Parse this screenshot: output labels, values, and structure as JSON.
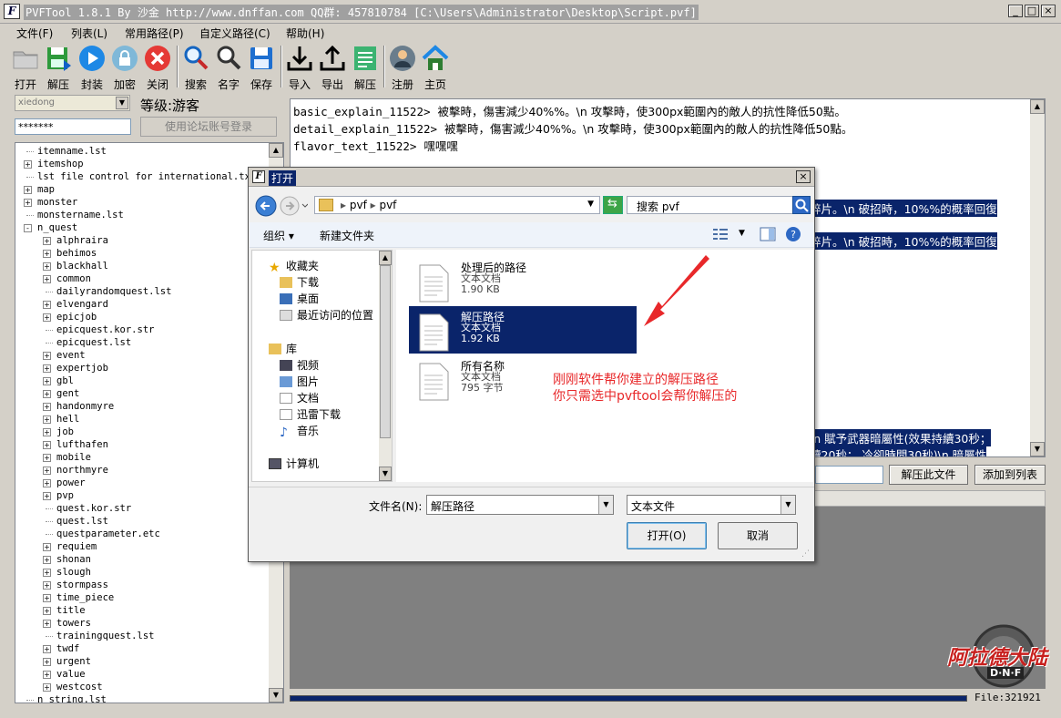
{
  "window": {
    "title": "PVFTool 1.8.1 By 沙金 http://www.dnffan.com QQ群: 457810784 [C:\\Users\\Administrator\\Desktop\\Script.pvf]",
    "app_icon": "F",
    "minimize": "_",
    "maximize": "□",
    "close": "×"
  },
  "menu": [
    "文件(F)",
    "列表(L)",
    "常用路径(P)",
    "自定义路径(C)",
    "帮助(H)"
  ],
  "toolbar": [
    {
      "label": "打开",
      "icon": "folder-icon"
    },
    {
      "label": "解压",
      "icon": "save-green-icon"
    },
    {
      "label": "封装",
      "icon": "play-icon"
    },
    {
      "label": "加密",
      "icon": "lock-icon"
    },
    {
      "label": "关闭",
      "icon": "close-red-icon"
    },
    {
      "label": "搜索",
      "icon": "magnifier-icon"
    },
    {
      "label": "名字",
      "icon": "magnifier-icon"
    },
    {
      "label": "保存",
      "icon": "floppy-icon"
    },
    {
      "label": "导入",
      "icon": "download-icon"
    },
    {
      "label": "导出",
      "icon": "upload-icon"
    },
    {
      "label": "解压",
      "icon": "document-green-icon"
    },
    {
      "label": "注册",
      "icon": "user-icon"
    },
    {
      "label": "主页",
      "icon": "home-icon"
    }
  ],
  "login": {
    "user": "xiedong",
    "level": "等级:游客",
    "password": "*******",
    "forum_login": "使用论坛账号登录"
  },
  "tree": [
    {
      "label": "itemname.lst",
      "indent": 0,
      "expand": ""
    },
    {
      "label": "itemshop",
      "indent": 0,
      "expand": "+"
    },
    {
      "label": "lst file control for international.txt",
      "indent": 0,
      "expand": ""
    },
    {
      "label": "map",
      "indent": 0,
      "expand": "+"
    },
    {
      "label": "monster",
      "indent": 0,
      "expand": "+"
    },
    {
      "label": "monstername.lst",
      "indent": 0,
      "expand": ""
    },
    {
      "label": "n_quest",
      "indent": 0,
      "expand": "-"
    },
    {
      "label": "alphraira",
      "indent": 1,
      "expand": "+"
    },
    {
      "label": "behimos",
      "indent": 1,
      "expand": "+"
    },
    {
      "label": "blackhall",
      "indent": 1,
      "expand": "+"
    },
    {
      "label": "common",
      "indent": 1,
      "expand": "+"
    },
    {
      "label": "dailyrandomquest.lst",
      "indent": 1,
      "expand": ""
    },
    {
      "label": "elvengard",
      "indent": 1,
      "expand": "+"
    },
    {
      "label": "epicjob",
      "indent": 1,
      "expand": "+"
    },
    {
      "label": "epicquest.kor.str",
      "indent": 1,
      "expand": ""
    },
    {
      "label": "epicquest.lst",
      "indent": 1,
      "expand": ""
    },
    {
      "label": "event",
      "indent": 1,
      "expand": "+"
    },
    {
      "label": "expertjob",
      "indent": 1,
      "expand": "+"
    },
    {
      "label": "gbl",
      "indent": 1,
      "expand": "+"
    },
    {
      "label": "gent",
      "indent": 1,
      "expand": "+"
    },
    {
      "label": "handonmyre",
      "indent": 1,
      "expand": "+"
    },
    {
      "label": "hell",
      "indent": 1,
      "expand": "+"
    },
    {
      "label": "job",
      "indent": 1,
      "expand": "+"
    },
    {
      "label": "lufthafen",
      "indent": 1,
      "expand": "+"
    },
    {
      "label": "mobile",
      "indent": 1,
      "expand": "+"
    },
    {
      "label": "northmyre",
      "indent": 1,
      "expand": "+"
    },
    {
      "label": "power",
      "indent": 1,
      "expand": "+"
    },
    {
      "label": "pvp",
      "indent": 1,
      "expand": "+"
    },
    {
      "label": "quest.kor.str",
      "indent": 1,
      "expand": ""
    },
    {
      "label": "quest.lst",
      "indent": 1,
      "expand": ""
    },
    {
      "label": "questparameter.etc",
      "indent": 1,
      "expand": ""
    },
    {
      "label": "requiem",
      "indent": 1,
      "expand": "+"
    },
    {
      "label": "shonan",
      "indent": 1,
      "expand": "+"
    },
    {
      "label": "slough",
      "indent": 1,
      "expand": "+"
    },
    {
      "label": "stormpass",
      "indent": 1,
      "expand": "+"
    },
    {
      "label": "time_piece",
      "indent": 1,
      "expand": "+"
    },
    {
      "label": "title",
      "indent": 1,
      "expand": "+"
    },
    {
      "label": "towers",
      "indent": 1,
      "expand": "+"
    },
    {
      "label": "trainingquest.lst",
      "indent": 1,
      "expand": ""
    },
    {
      "label": "twdf",
      "indent": 1,
      "expand": "+"
    },
    {
      "label": "urgent",
      "indent": 1,
      "expand": "+"
    },
    {
      "label": "value",
      "indent": 1,
      "expand": "+"
    },
    {
      "label": "westcost",
      "indent": 1,
      "expand": "+"
    },
    {
      "label": "n_string.lst",
      "indent": 0,
      "expand": ""
    }
  ],
  "text_lines": [
    {
      "key": "basic_explain_11522>",
      "value": "被擊時，傷害減少40%%。\\n  攻擊時，使300px範圍內的敵人的抗性降低50點。"
    },
    {
      "key": "detail_explain_11522>",
      "value": "被擊時，傷害減少40%%。\\n  攻擊時，使300px範圍內的敵人的抗性降低50點。"
    },
    {
      "key": "flavor_text_11522>",
      "value": "嘿嘿嘿"
    }
  ],
  "highlight_fragments": [
    "碎片。\\n  破招時，10%%的概率回復",
    "碎片。\\n  破招時，10%%的概率回復",
    "\\n  賦予武器暗屬性(效果持續30秒；",
    "續20秒； 冷卻時間30秒)\\n  暗屬性"
  ],
  "actions": {
    "extract_file": "解压此文件",
    "add_to_list": "添加到列表"
  },
  "status": {
    "file_count": "File:321921",
    "progress": 1.0
  },
  "logo_text": "阿拉德大陆",
  "logo_sub": "D·N·F",
  "dialog": {
    "title": "打开",
    "close": "×",
    "address_parts": [
      "pvf",
      "pvf"
    ],
    "search_placeholder": "搜索 pvf",
    "organize": "组织 ▾",
    "new_folder": "新建文件夹",
    "nav": {
      "favorites": "收藏夹",
      "favorites_items": [
        "下载",
        "桌面",
        "最近访问的位置"
      ],
      "library": "库",
      "library_items": [
        "视频",
        "图片",
        "文档",
        "迅雷下载",
        "音乐"
      ],
      "computer": "计算机"
    },
    "files": [
      {
        "name": "处理后的路径",
        "type": "文本文档",
        "size": "1.90 KB",
        "selected": false
      },
      {
        "name": "解压路径",
        "type": "文本文档",
        "size": "1.92 KB",
        "selected": true
      },
      {
        "name": "所有名称",
        "type": "文本文档",
        "size": "795 字节",
        "selected": false
      }
    ],
    "annotation": [
      "刚刚软件帮你建立的解压路径",
      "你只需选中pvftool会帮你解压的"
    ],
    "filename_label": "文件名(N):",
    "filename_value": "解压路径",
    "filetype_value": "文本文件",
    "open_button": "打开(O)",
    "cancel_button": "取消"
  },
  "colors": {
    "selection": "#0a246a",
    "annotation": "#e8282a",
    "chrome": "#d4d0c8"
  }
}
